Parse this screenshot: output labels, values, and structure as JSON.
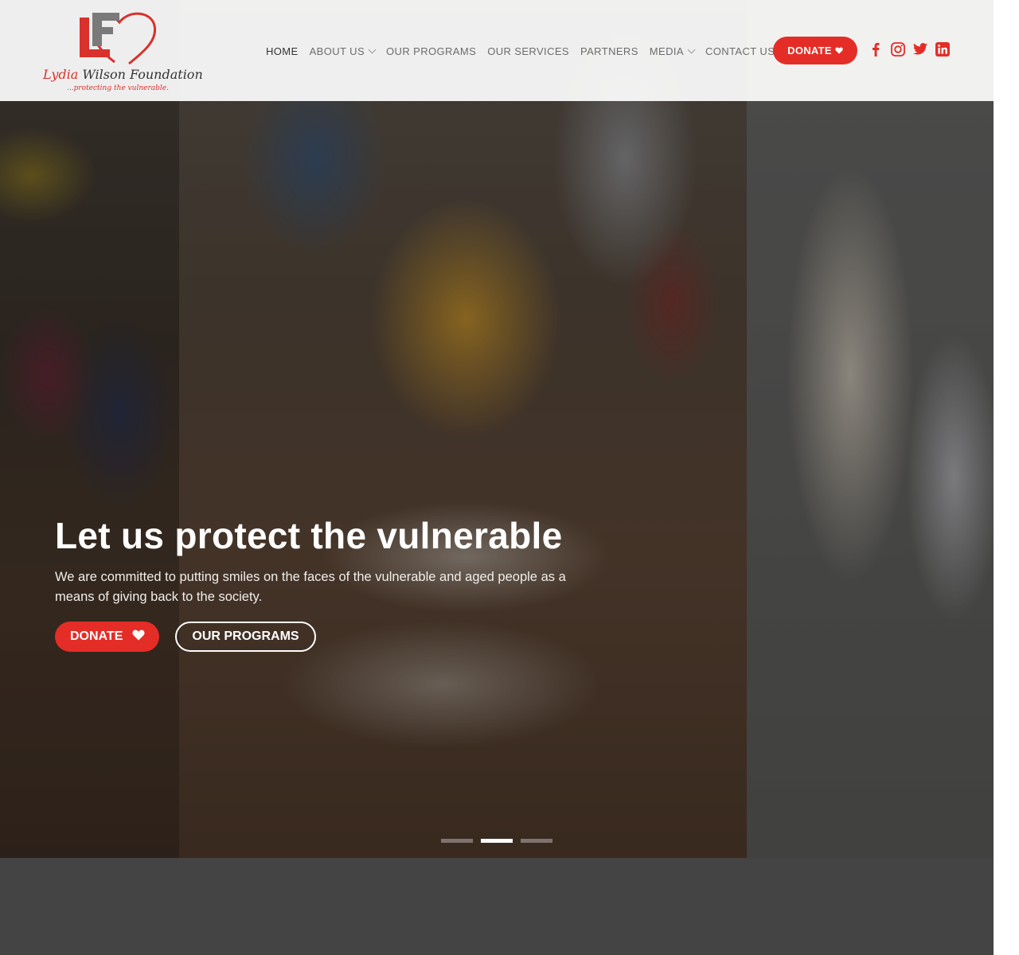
{
  "brand": {
    "logo_letters": "LF",
    "name_first": "Lydia",
    "name_rest": "Wilson Foundation",
    "tagline": "...protecting the vulnerable."
  },
  "nav": {
    "items": [
      {
        "label": "HOME",
        "active": true,
        "has_dropdown": false
      },
      {
        "label": "ABOUT US",
        "active": false,
        "has_dropdown": true
      },
      {
        "label": "OUR PROGRAMS",
        "active": false,
        "has_dropdown": false
      },
      {
        "label": "OUR SERVICES",
        "active": false,
        "has_dropdown": false
      },
      {
        "label": "PARTNERS",
        "active": false,
        "has_dropdown": false
      },
      {
        "label": "MEDIA",
        "active": false,
        "has_dropdown": true
      },
      {
        "label": "CONTACT US",
        "active": false,
        "has_dropdown": false
      }
    ],
    "donate_label": "DONATE",
    "social_icons": [
      "facebook-icon",
      "instagram-icon",
      "twitter-icon",
      "linkedin-icon"
    ]
  },
  "hero": {
    "title": "Let us protect the vulnerable",
    "subtitle": "We are committed to putting smiles on the faces of the vulnerable and aged people as a means of giving back to the society.",
    "donate_label": "DONATE",
    "programs_label": "OUR PROGRAMS",
    "slides_total": 3,
    "active_slide": 2
  },
  "colors": {
    "accent": "#e52d27",
    "header_bg": "#ffffff",
    "footer_band": "#444444"
  }
}
